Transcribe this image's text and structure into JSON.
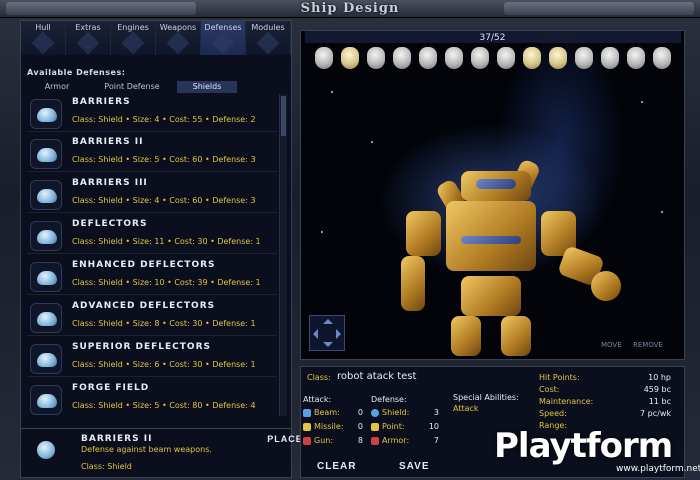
{
  "window": {
    "title": "Ship Design"
  },
  "tabs": [
    {
      "label": "Hull"
    },
    {
      "label": "Extras"
    },
    {
      "label": "Engines"
    },
    {
      "label": "Weapons"
    },
    {
      "label": "Defenses"
    },
    {
      "label": "Modules"
    }
  ],
  "available_label": "Available Defenses:",
  "subtabs": [
    {
      "label": "Armor"
    },
    {
      "label": "Point Defense"
    },
    {
      "label": "Shields"
    }
  ],
  "defenses": [
    {
      "name": "Barriers",
      "stats": "Class: Shield • Size: 4 • Cost: 55 • Defense: 2"
    },
    {
      "name": "Barriers II",
      "stats": "Class: Shield • Size: 5 • Cost: 60 • Defense: 3"
    },
    {
      "name": "Barriers III",
      "stats": "Class: Shield • Size: 4 • Cost: 60 • Defense: 3"
    },
    {
      "name": "Deflectors",
      "stats": "Class: Shield • Size: 11 • Cost: 30 • Defense: 1"
    },
    {
      "name": "Enhanced Deflectors",
      "stats": "Class: Shield • Size: 10 • Cost: 39 • Defense: 1"
    },
    {
      "name": "Advanced Deflectors",
      "stats": "Class: Shield • Size: 8 • Cost: 30 • Defense: 1"
    },
    {
      "name": "Superior Deflectors",
      "stats": "Class: Shield • Size: 6 • Cost: 30 • Defense: 1"
    },
    {
      "name": "Forge Field",
      "stats": "Class: Shield • Size: 5 • Cost: 80 • Defense: 4"
    }
  ],
  "detail": {
    "name": "BARRIERS II",
    "description": "Defense against beam weapons.",
    "class": "Class: Shield",
    "place_label": "PLACE"
  },
  "viewport": {
    "slots_used": "37/52",
    "move_label": "MOVE",
    "remove_label": "REMOVE"
  },
  "design": {
    "class_label": "Class:",
    "class_value": "robot atack test",
    "attack_header": "Attack:",
    "defense_header": "Defense:",
    "attack": [
      {
        "label": "Beam:",
        "value": "0"
      },
      {
        "label": "Missile:",
        "value": "0"
      },
      {
        "label": "Gun:",
        "value": "8"
      }
    ],
    "defense": [
      {
        "label": "Shield:",
        "value": "3"
      },
      {
        "label": "Point:",
        "value": "10"
      },
      {
        "label": "Armor:",
        "value": "7"
      }
    ],
    "special_header": "Special Abilities:",
    "special_value": "Attack",
    "stats": [
      {
        "label": "Hit Points:",
        "value": "10 hp"
      },
      {
        "label": "Cost:",
        "value": "459 bc"
      },
      {
        "label": "Maintenance:",
        "value": "11 bc"
      },
      {
        "label": "Speed:",
        "value": "7 pc/wk"
      },
      {
        "label": "Range:",
        "value": ""
      }
    ],
    "clear_label": "CLEAR",
    "save_label": "SAVE"
  },
  "watermark": {
    "brand": "Playtform",
    "url": "www.playtform.net"
  },
  "colors": {
    "accent": "#e2c440",
    "panel": "#0b0f1d",
    "border": "#3a4254"
  }
}
